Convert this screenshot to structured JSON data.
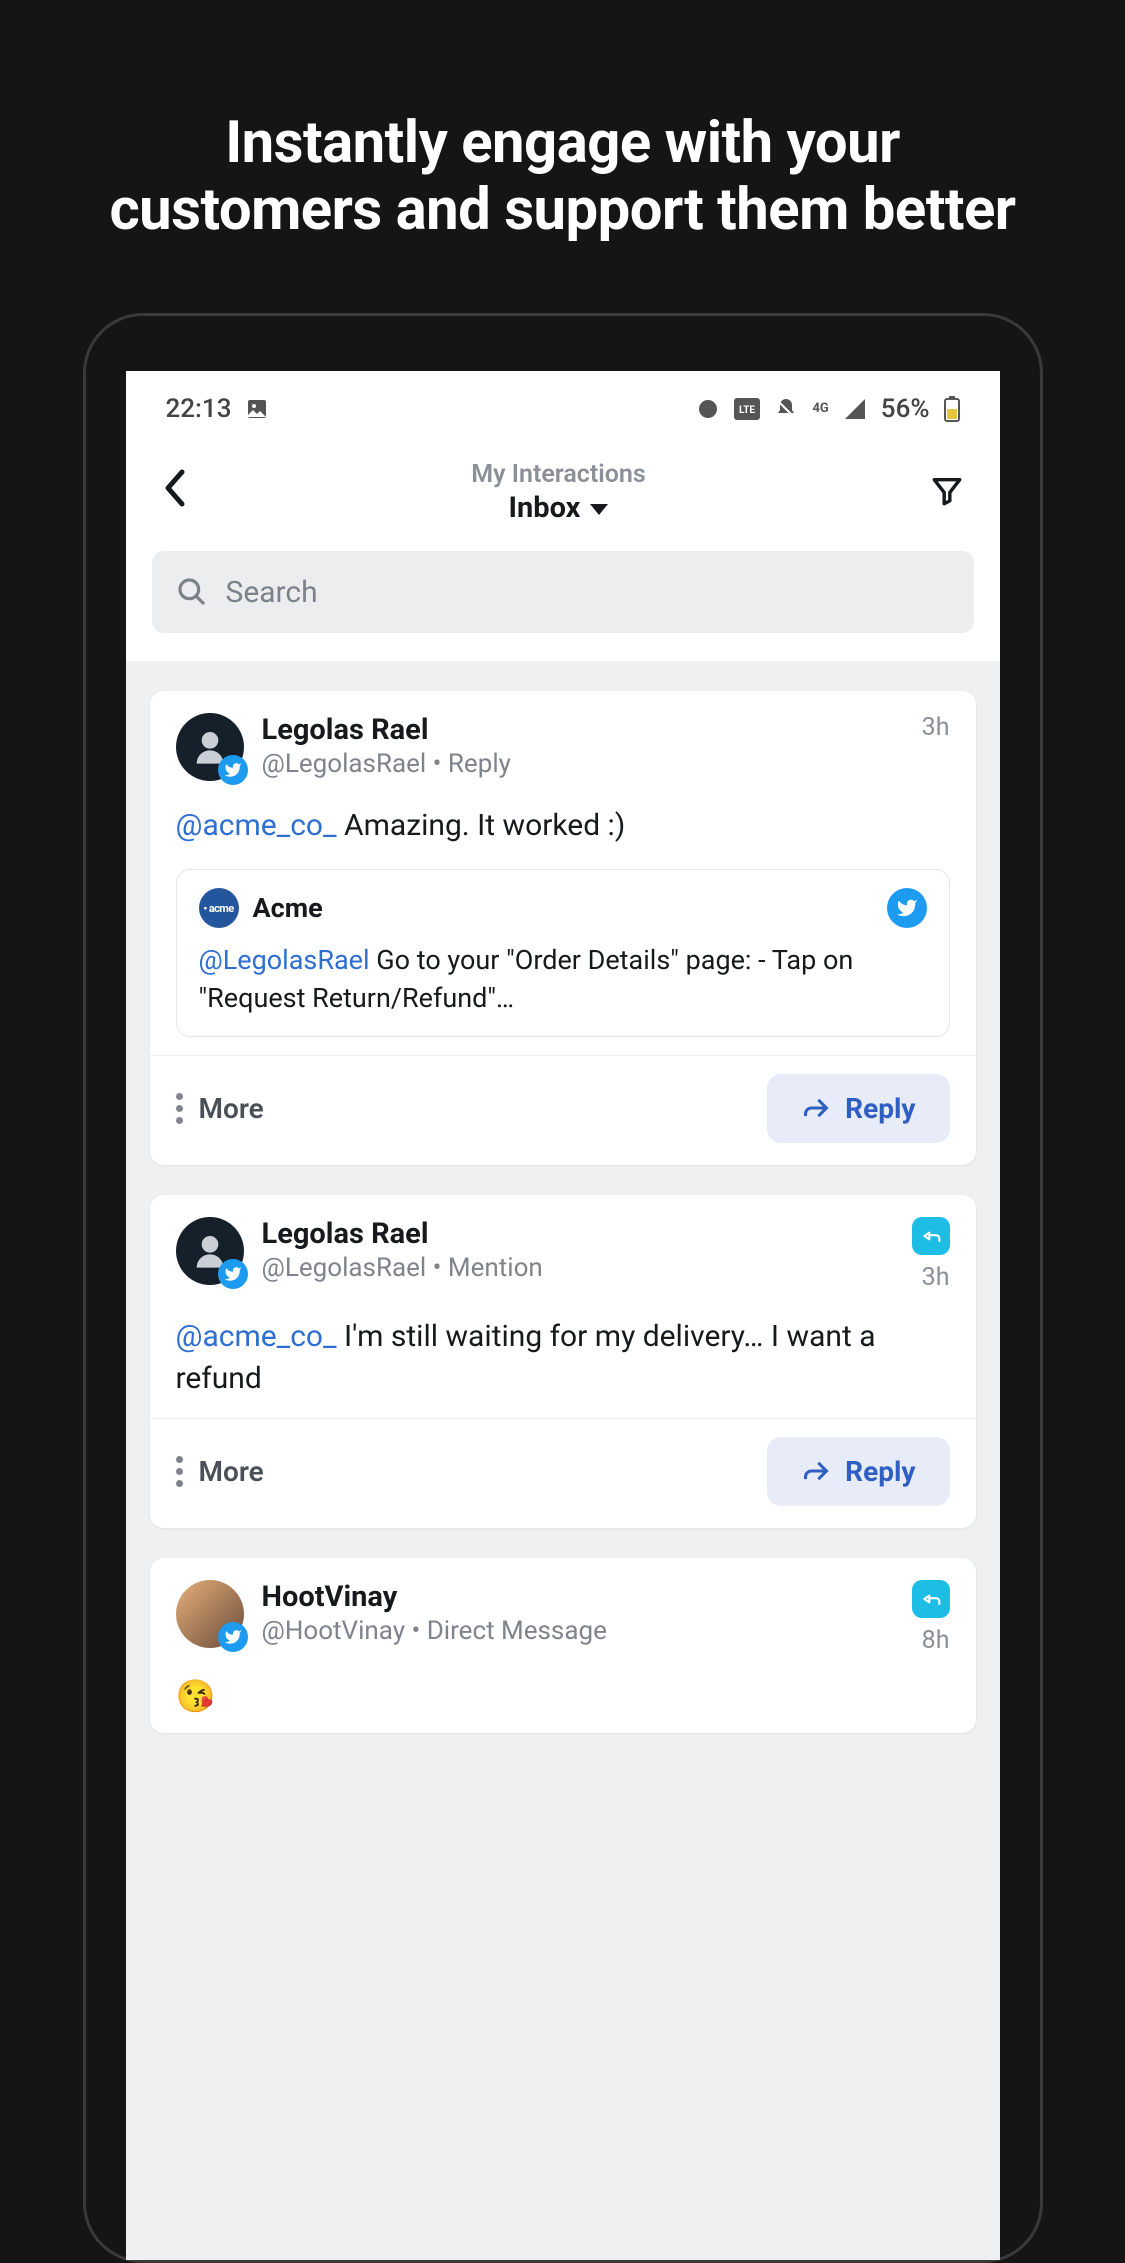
{
  "promo": {
    "title": "Instantly engage with your customers and support them better"
  },
  "status": {
    "time": "22:13",
    "battery": "56%"
  },
  "header": {
    "sub": "My Interactions",
    "main": "Inbox"
  },
  "search": {
    "placeholder": "Search"
  },
  "actions": {
    "more": "More",
    "reply": "Reply"
  },
  "cards": [
    {
      "name": "Legolas Rael",
      "handle": "@LegolasRael",
      "type": "Reply",
      "time": "3h",
      "mention": "@acme_co_",
      "text": " Amazing. It worked :)",
      "has_reply_badge": false,
      "quoted": {
        "name": "Acme",
        "avatar_text": "• acme",
        "mention": "@LegolasRael",
        "text": " Go to your \"Order Details\" page: - Tap on \"Request Return/Refund\"…"
      }
    },
    {
      "name": "Legolas Rael",
      "handle": "@LegolasRael",
      "type": "Mention",
      "time": "3h",
      "mention": "@acme_co_",
      "text": " I'm still waiting for my delivery… I want a refund",
      "has_reply_badge": true
    },
    {
      "name": "HootVinay",
      "handle": "@HootVinay",
      "type": "Direct Message",
      "time": "8h",
      "emoji": "😘",
      "has_reply_badge": true,
      "avatar_variant": "gradient"
    }
  ]
}
